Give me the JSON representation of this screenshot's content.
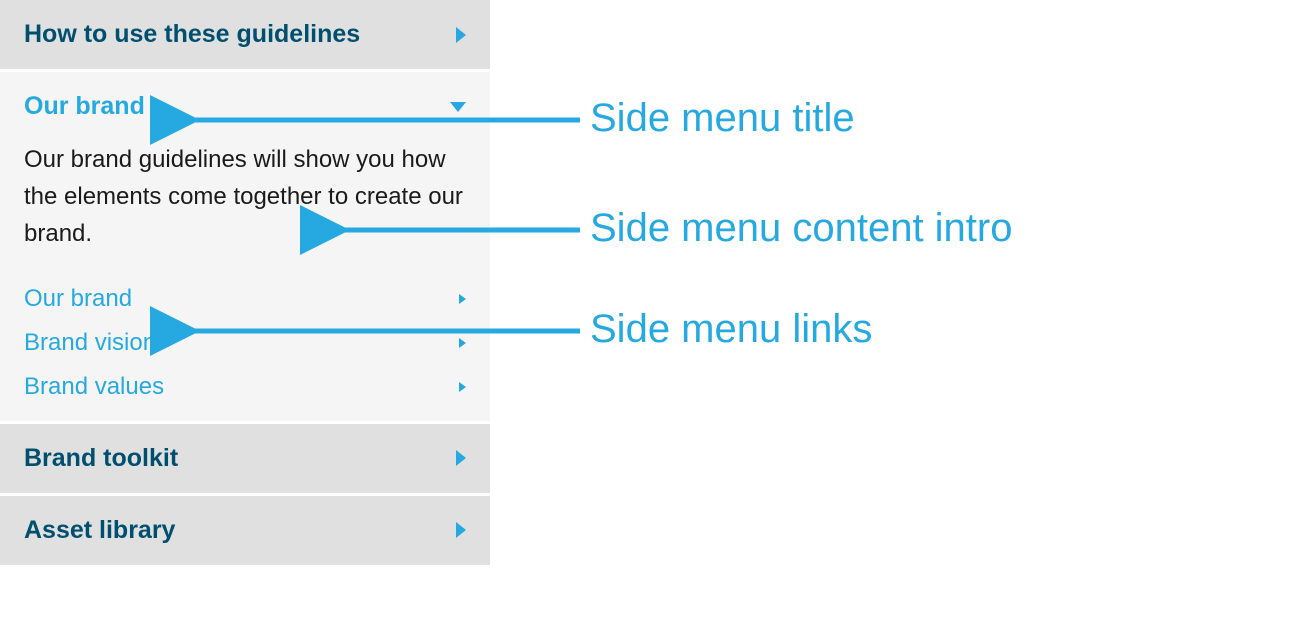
{
  "sidebar": {
    "headers": [
      {
        "label": "How to use these guidelines"
      },
      {
        "label": "Brand toolkit"
      },
      {
        "label": "Asset library"
      }
    ],
    "expanded": {
      "title": "Our brand",
      "intro": "Our brand guidelines will show you how the elements come together to create our brand.",
      "links": [
        {
          "label": "Our brand"
        },
        {
          "label": "Brand vision"
        },
        {
          "label": "Brand values"
        }
      ]
    }
  },
  "annotations": {
    "title": "Side menu title",
    "intro": "Side menu content intro",
    "links": "Side menu links"
  },
  "colors": {
    "accent": "#26a9e0",
    "darkTeal": "#004f6e",
    "headerBg": "#e0e0e0",
    "sectionBg": "#f5f5f5"
  }
}
